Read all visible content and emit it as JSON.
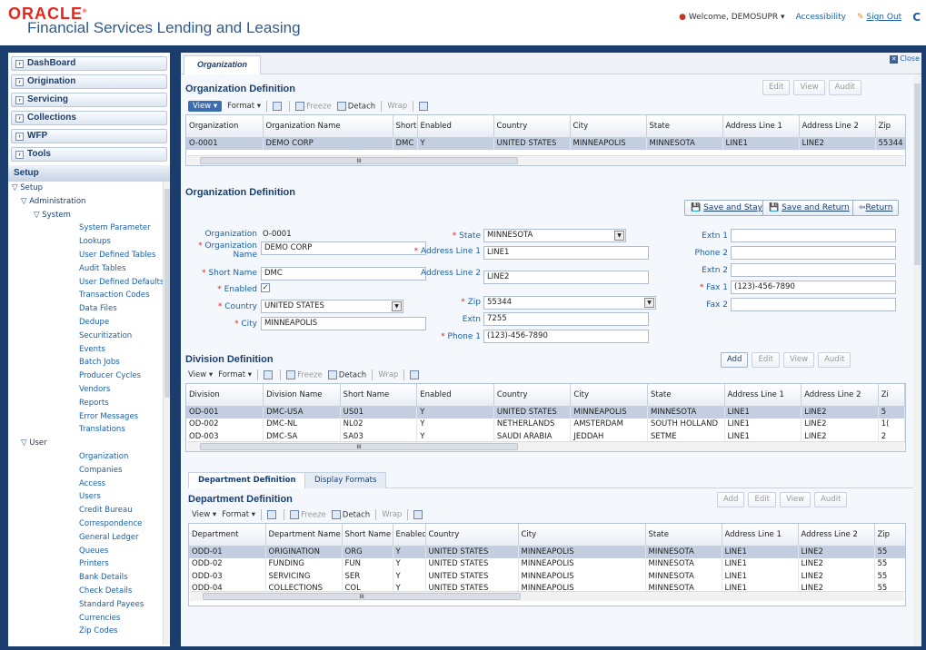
{
  "header": {
    "brand": "ORACLE",
    "brand_reg": "®",
    "app_title": "Financial Services Lending and Leasing",
    "welcome": "Welcome, DEMOSUPR",
    "accessibility": "Accessibility",
    "sign_out": "Sign Out"
  },
  "sidebar": {
    "items": [
      {
        "label": "DashBoard"
      },
      {
        "label": "Origination"
      },
      {
        "label": "Servicing"
      },
      {
        "label": "Collections"
      },
      {
        "label": "WFP"
      },
      {
        "label": "Tools"
      }
    ],
    "section": "Setup",
    "tree": [
      {
        "label": "Setup",
        "level": 0,
        "prefix": "▽"
      },
      {
        "label": "Administration",
        "level": 1,
        "prefix": "▽"
      },
      {
        "label": "System",
        "level": 2,
        "prefix": "▽"
      },
      {
        "label": "System Parameter",
        "level": 3
      },
      {
        "label": "Lookups",
        "level": 3
      },
      {
        "label": "User Defined Tables",
        "level": 3
      },
      {
        "label": "Audit Tables",
        "level": 3
      },
      {
        "label": "User Defined Defaults",
        "level": 3
      },
      {
        "label": "Transaction Codes",
        "level": 3
      },
      {
        "label": "Data Files",
        "level": 3
      },
      {
        "label": "Dedupe",
        "level": 3
      },
      {
        "label": "Securitization",
        "level": 3
      },
      {
        "label": "Events",
        "level": 3
      },
      {
        "label": "Batch Jobs",
        "level": 3
      },
      {
        "label": "Producer Cycles",
        "level": 3
      },
      {
        "label": "Vendors",
        "level": 3
      },
      {
        "label": "Reports",
        "level": 3
      },
      {
        "label": "Error Messages",
        "level": 3
      },
      {
        "label": "Translations",
        "level": 3
      },
      {
        "label": "User",
        "level": 1,
        "prefix": "▽"
      },
      {
        "label": "Organization",
        "level": 3
      },
      {
        "label": "Companies",
        "level": 3
      },
      {
        "label": "Access",
        "level": 3
      },
      {
        "label": "Users",
        "level": 3
      },
      {
        "label": "Credit Bureau",
        "level": 3
      },
      {
        "label": "Correspondence",
        "level": 3
      },
      {
        "label": "General Ledger",
        "level": 3
      },
      {
        "label": "Queues",
        "level": 3
      },
      {
        "label": "Printers",
        "level": 3
      },
      {
        "label": "Bank Details",
        "level": 3
      },
      {
        "label": "Check Details",
        "level": 3
      },
      {
        "label": "Standard Payees",
        "level": 3
      },
      {
        "label": "Currencies",
        "level": 3
      },
      {
        "label": "Zip Codes",
        "level": 3
      }
    ]
  },
  "main": {
    "tab": "Organization",
    "close": "Close"
  },
  "toolbar": {
    "view": "View ▾",
    "format": "Format ▾",
    "freeze": "Freeze",
    "detach": "Detach",
    "wrap": "Wrap",
    "add": "Add",
    "edit": "Edit",
    "viewbtn": "View",
    "audit": "Audit"
  },
  "org_grid": {
    "title": "Organization Definition",
    "headers": [
      "Organization",
      "Organization Name",
      "Short Name",
      "Enabled",
      "Country",
      "City",
      "State",
      "Address Line 1",
      "Address Line 2",
      "Zip"
    ],
    "rows": [
      [
        "O-0001",
        "DEMO CORP",
        "DMC",
        "Y",
        "UNITED STATES",
        "MINNEAPOLIS",
        "MINNESOTA",
        "LINE1",
        "LINE2",
        "55344"
      ]
    ]
  },
  "org_form": {
    "title": "Organization Definition",
    "save_stay": "Save and Stay",
    "save_return": "Save and Return",
    "return": "Return",
    "organization_label": "Organization",
    "organization": "O-0001",
    "org_name_label": "Organization Name",
    "org_name": "DEMO CORP",
    "short_name_label": "Short Name",
    "short_name": "DMC",
    "enabled_label": "Enabled",
    "country_label": "Country",
    "country": "UNITED STATES",
    "city_label": "City",
    "city": "MINNEAPOLIS",
    "state_label": "State",
    "state": "MINNESOTA",
    "addr1_label": "Address Line 1",
    "addr1": "LINE1",
    "addr2_label": "Address Line 2",
    "addr2": "LINE2",
    "zip_label": "Zip",
    "zip": "55344",
    "extn_label": "Extn",
    "extn": "7255",
    "phone1_label": "Phone 1",
    "phone1": "(123)-456-7890",
    "extn1_label": "Extn 1",
    "phone2_label": "Phone 2",
    "extn2_label": "Extn 2",
    "fax1_label": "Fax 1",
    "fax1": "(123)-456-7890",
    "fax2_label": "Fax 2"
  },
  "div_grid": {
    "title": "Division Definition",
    "headers": [
      "Division",
      "Division Name",
      "Short Name",
      "Enabled",
      "Country",
      "City",
      "State",
      "Address Line 1",
      "Address Line 2",
      "Zi"
    ],
    "rows": [
      [
        "OD-001",
        "DMC-USA",
        "US01",
        "Y",
        "UNITED STATES",
        "MINNEAPOLIS",
        "MINNESOTA",
        "LINE1",
        "LINE2",
        "5"
      ],
      [
        "OD-002",
        "DMC-NL",
        "NL02",
        "Y",
        "NETHERLANDS",
        "AMSTERDAM",
        "SOUTH HOLLAND",
        "LINE1",
        "LINE2",
        "1("
      ],
      [
        "OD-003",
        "DMC-SA",
        "SA03",
        "Y",
        "SAUDI ARABIA",
        "JEDDAH",
        "SETME",
        "LINE1",
        "LINE2",
        "2"
      ]
    ]
  },
  "subtabs": {
    "dept": "Department Definition",
    "display": "Display Formats"
  },
  "dept_grid": {
    "title": "Department Definition",
    "headers": [
      "Department",
      "Department Name",
      "Short Name",
      "Enabled",
      "Country",
      "City",
      "State",
      "Address Line 1",
      "Address Line 2",
      "Zip"
    ],
    "rows": [
      [
        "ODD-01",
        "ORIGINATION",
        "ORG",
        "Y",
        "UNITED STATES",
        "MINNEAPOLIS",
        "MINNESOTA",
        "LINE1",
        "LINE2",
        "55"
      ],
      [
        "ODD-02",
        "FUNDING",
        "FUN",
        "Y",
        "UNITED STATES",
        "MINNEAPOLIS",
        "MINNESOTA",
        "LINE1",
        "LINE2",
        "55"
      ],
      [
        "ODD-03",
        "SERVICING",
        "SER",
        "Y",
        "UNITED STATES",
        "MINNEAPOLIS",
        "MINNESOTA",
        "LINE1",
        "LINE2",
        "55"
      ],
      [
        "ODD-04",
        "COLLECTIONS",
        "COL",
        "Y",
        "UNITED STATES",
        "MINNEAPOLIS",
        "MINNESOTA",
        "LINE1",
        "LINE2",
        "55"
      ]
    ]
  }
}
